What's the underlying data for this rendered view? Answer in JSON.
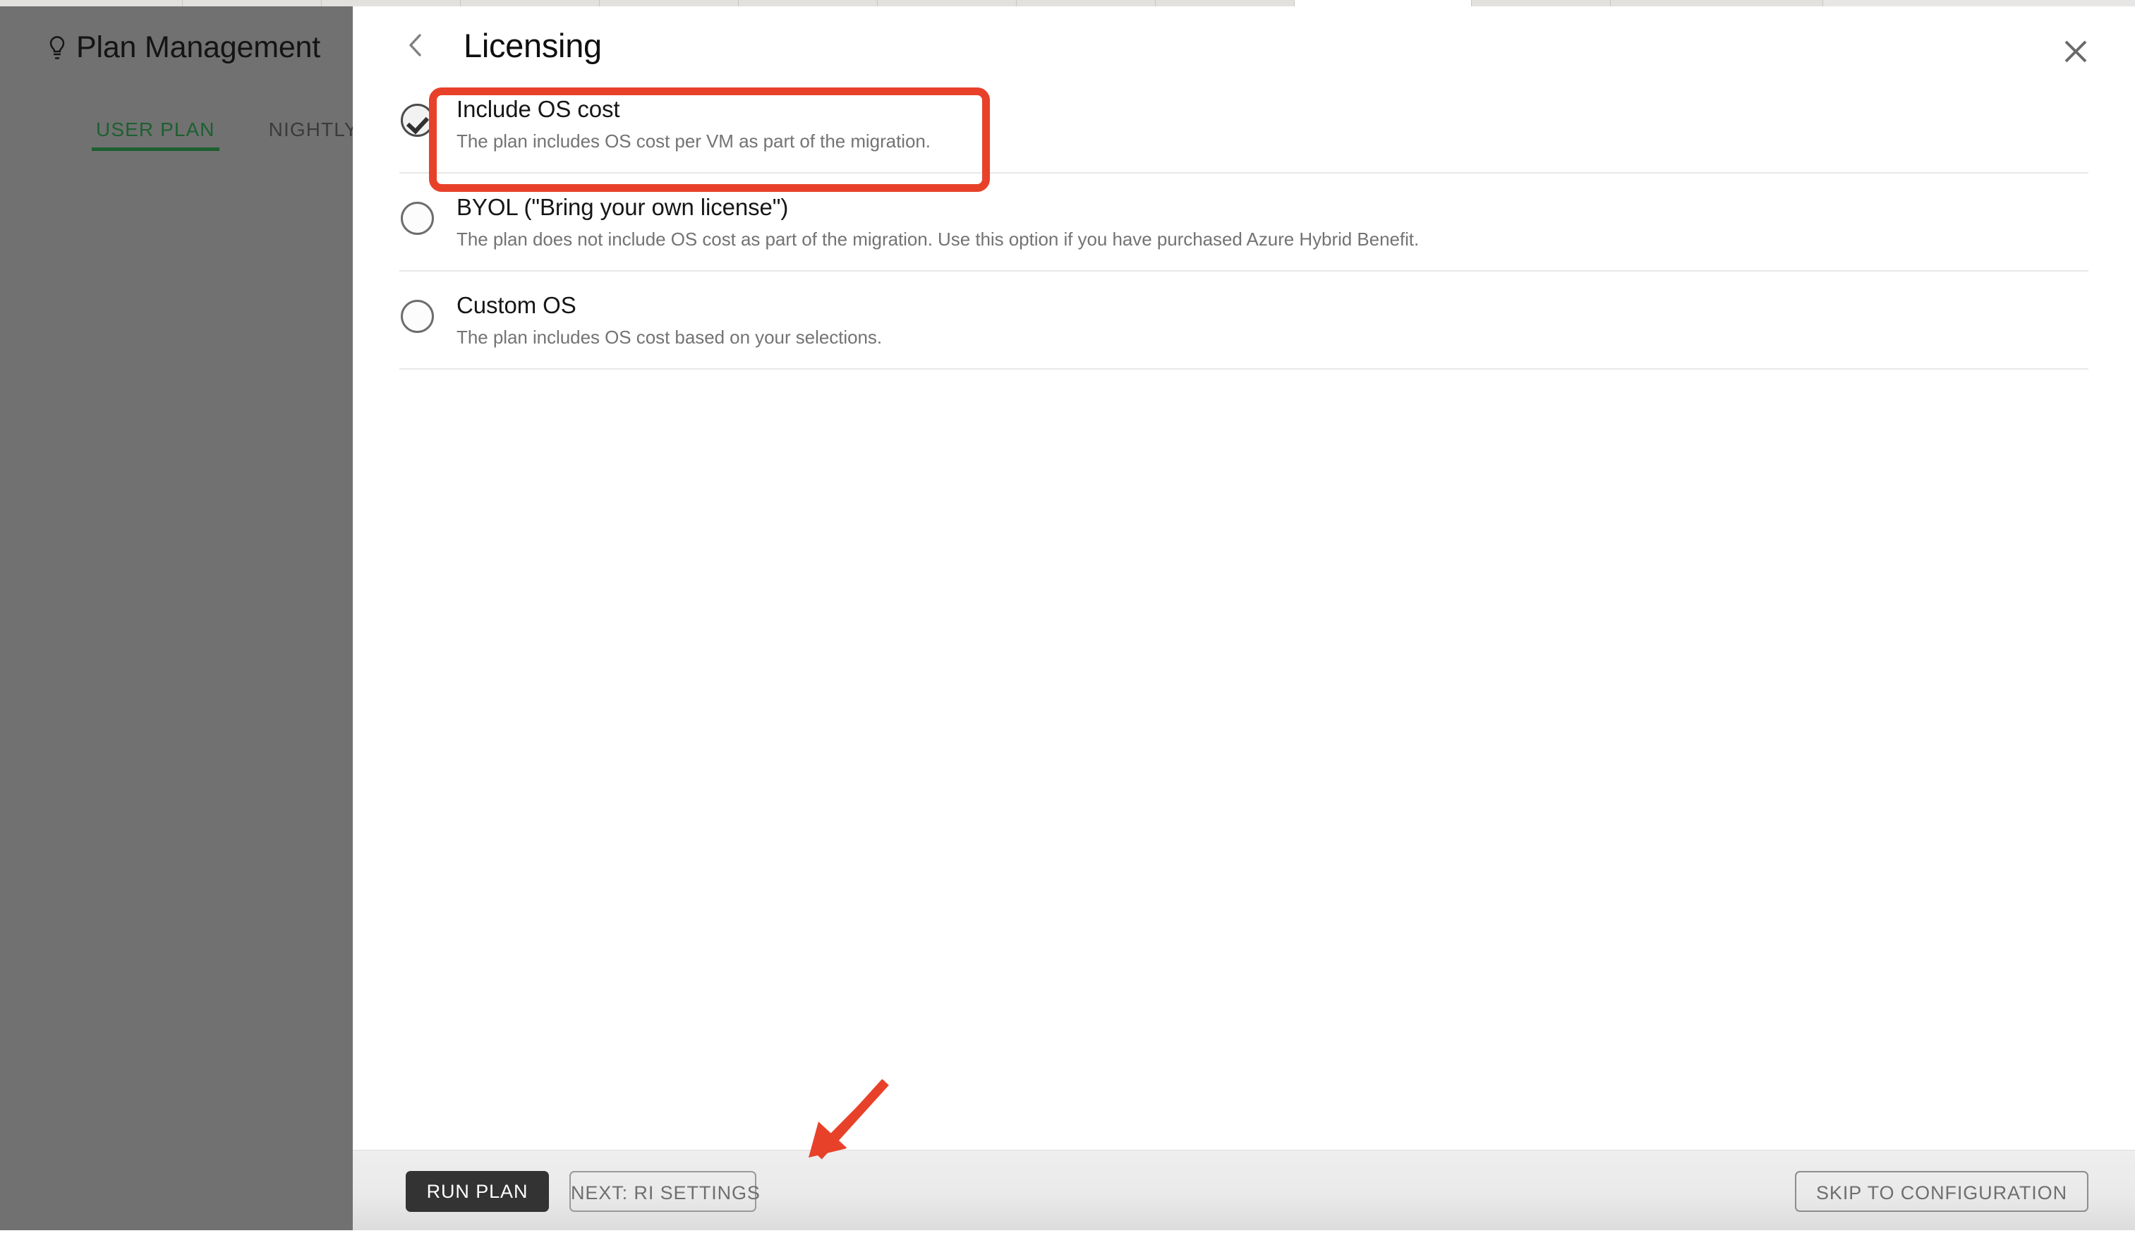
{
  "browser": {
    "tabstrip_tabs": 12,
    "active_tab_index": 9
  },
  "background_app": {
    "icon": "lightbulb-icon",
    "title": "Plan Management",
    "tabs": [
      {
        "label": "USER PLAN",
        "selected": true
      },
      {
        "label": "NIGHTLY",
        "selected": false
      }
    ],
    "overlay_color": "#717171"
  },
  "panel": {
    "title": "Licensing",
    "back_icon": "chevron-left-icon",
    "close_icon": "close-icon",
    "options": [
      {
        "label": "Include OS cost",
        "description": "The plan includes OS cost per VM as part of the migration.",
        "selected": true,
        "highlighted": true
      },
      {
        "label": "BYOL (\"Bring your own license\")",
        "description": "The plan does not include OS cost as part of the migration. Use this option if you have purchased Azure Hybrid Benefit.",
        "selected": false,
        "highlighted": false
      },
      {
        "label": "Custom OS",
        "description": "The plan includes OS cost based on your selections.",
        "selected": false,
        "highlighted": false
      }
    ]
  },
  "footer": {
    "run_plan_label": "RUN PLAN",
    "next_ri_label": "NEXT: RI SETTINGS",
    "skip_config_label": "SKIP TO CONFIGURATION"
  },
  "annotations": {
    "highlight_color": "#e8412a",
    "arrow_color": "#e8412a",
    "arrow_target": "NEXT: RI SETTINGS"
  }
}
